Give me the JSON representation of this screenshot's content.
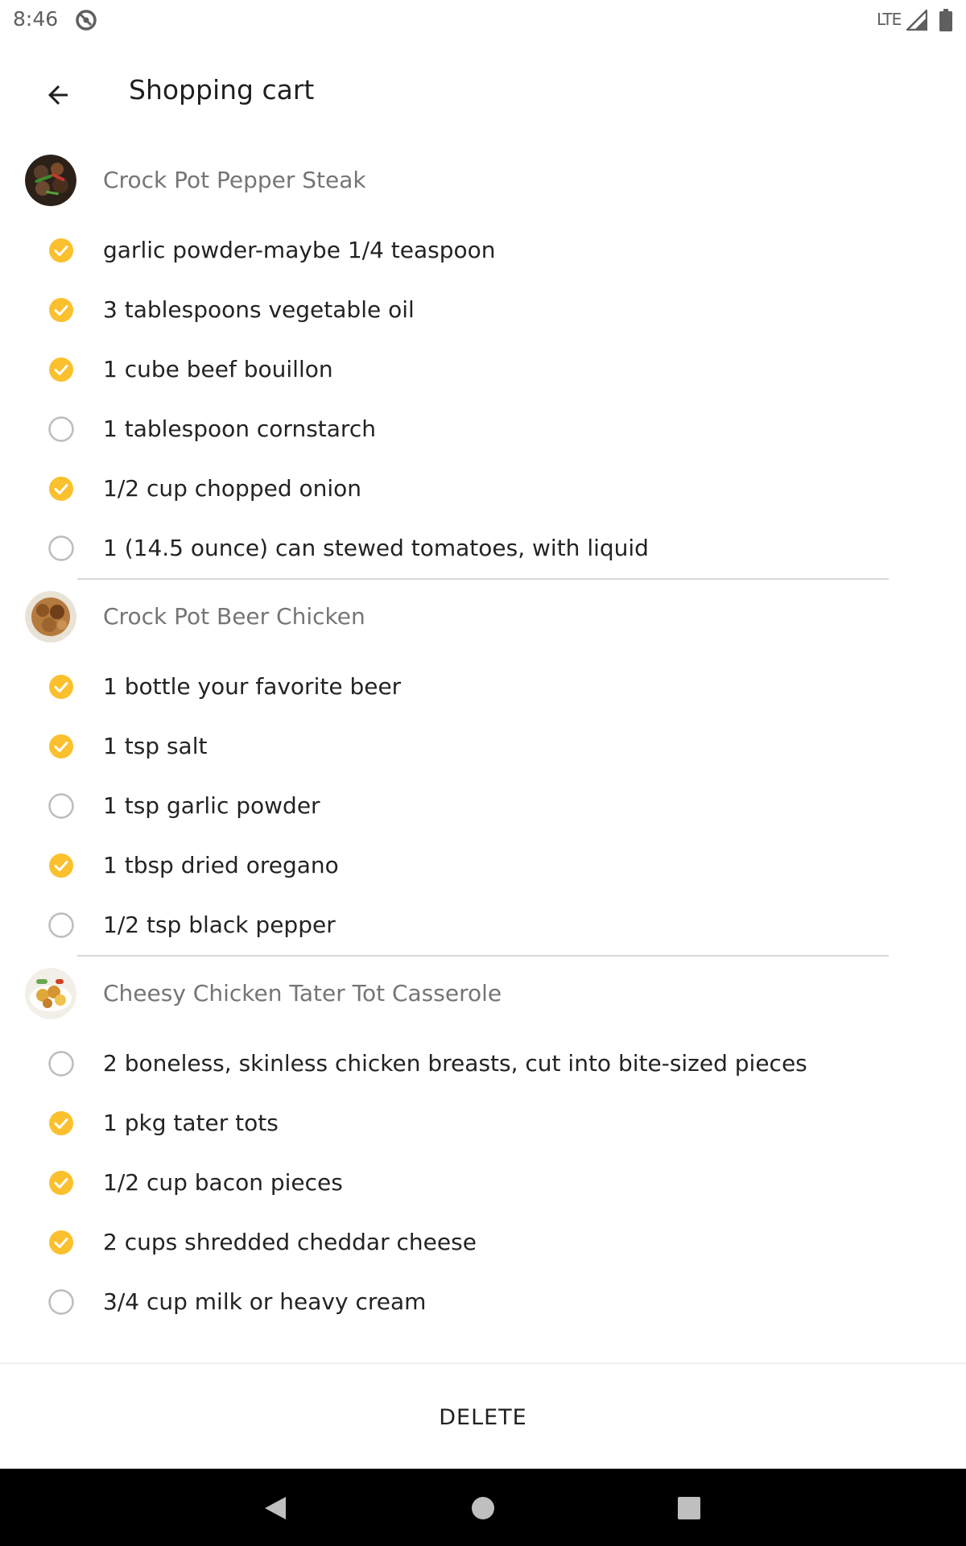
{
  "status_bar": {
    "time": "8:46",
    "network": "LTE",
    "icons": [
      "app-notification-icon",
      "signal-icon",
      "battery-icon"
    ]
  },
  "app_bar": {
    "title": "Shopping cart",
    "back_icon": "arrow-back-icon"
  },
  "colors": {
    "accent": "#FBC02D",
    "unchecked": "#bdbdbd",
    "recipe_text": "#757575"
  },
  "recipes": [
    {
      "name": "Crock Pot Pepper Steak",
      "ingredients": [
        {
          "text": "garlic powder-maybe 1/4 teaspoon",
          "checked": true
        },
        {
          "text": "3 tablespoons vegetable oil",
          "checked": true
        },
        {
          "text": "1 cube beef bouillon",
          "checked": true
        },
        {
          "text": "1 tablespoon cornstarch",
          "checked": false
        },
        {
          "text": "1/2 cup chopped onion",
          "checked": true
        },
        {
          "text": "1 (14.5 ounce) can stewed tomatoes, with liquid",
          "checked": false
        }
      ]
    },
    {
      "name": "Crock Pot Beer Chicken",
      "ingredients": [
        {
          "text": "1 bottle your favorite beer",
          "checked": true
        },
        {
          "text": "1 tsp salt",
          "checked": true
        },
        {
          "text": "1 tsp garlic powder",
          "checked": false
        },
        {
          "text": "1 tbsp dried oregano",
          "checked": true
        },
        {
          "text": "1/2 tsp black pepper",
          "checked": false
        }
      ]
    },
    {
      "name": "Cheesy Chicken Tater Tot Casserole",
      "ingredients": [
        {
          "text": "2 boneless, skinless chicken breasts, cut into bite-sized pieces",
          "checked": false
        },
        {
          "text": "1 pkg tater tots",
          "checked": true
        },
        {
          "text": "1/2 cup bacon pieces",
          "checked": true
        },
        {
          "text": "2 cups shredded cheddar cheese",
          "checked": true
        },
        {
          "text": "3/4 cup milk or heavy cream",
          "checked": false
        }
      ]
    }
  ],
  "actions": {
    "delete_label": "DELETE"
  },
  "nav_bar": {
    "items": [
      "back-triangle-icon",
      "home-circle-icon",
      "recents-square-icon"
    ]
  }
}
